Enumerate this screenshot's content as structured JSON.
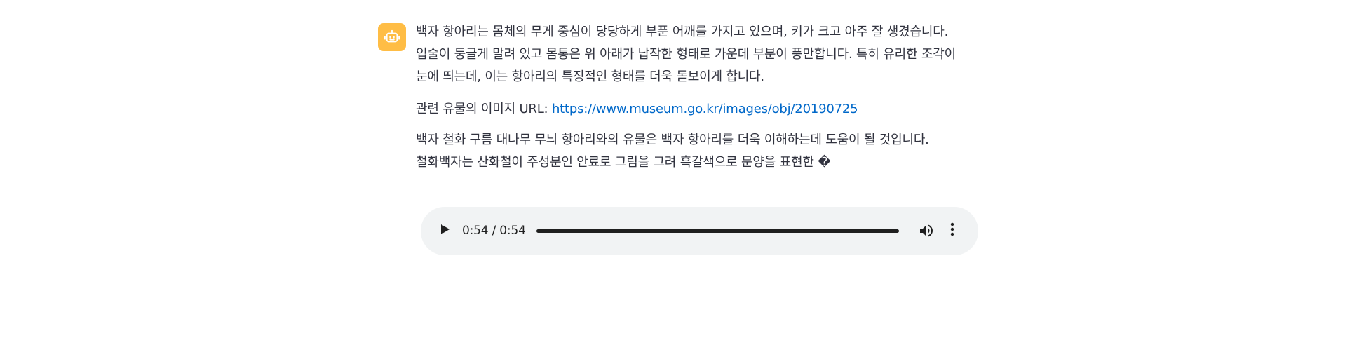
{
  "message": {
    "paragraph1": "백자 항아리는 몸체의 무게 중심이 당당하게 부푼 어깨를 가지고 있으며, 키가 크고 아주 잘 생겼습니다. 입술이 둥글게 말려 있고 몸통은 위 아래가 납작한 형태로 가운데 부분이 풍만합니다. 특히 유리한 조각이 눈에 띄는데, 이는 항아리의 특징적인 형태를 더욱 돋보이게 합니다.",
    "link_prefix": "관련 유물의 이미지 URL: ",
    "link_text": "https://www.museum.go.kr/images/obj/20190725",
    "paragraph3": "백자 철화 구름 대나무 무늬 항아리와의 유물은 백자 항아리를 더욱 이해하는데 도움이 될 것입니다. 철화백자는 산화철이 주성분인 안료로 그림을 그려 흑갈색으로 문양을 표현한 �"
  },
  "avatar": {
    "icon": "robot-icon",
    "color": "#ffbd45"
  },
  "audio": {
    "time": "0:54 / 0:54",
    "progress": 1.0
  },
  "colors": {
    "text": "#31333f",
    "link": "#0068c9",
    "player_bg": "#f1f3f4"
  }
}
